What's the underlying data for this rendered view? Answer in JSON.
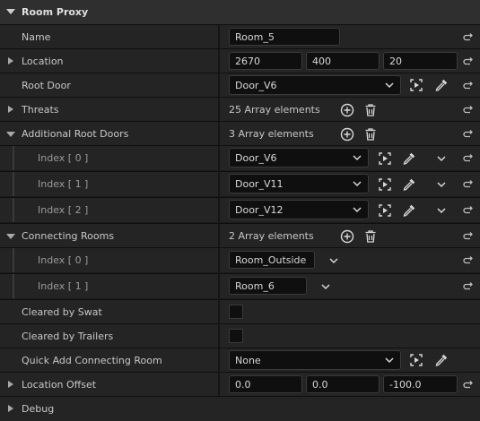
{
  "section": {
    "title": "Room Proxy"
  },
  "rows": {
    "name": {
      "label": "Name",
      "value": "Room_5"
    },
    "location": {
      "label": "Location",
      "x": "2670",
      "y": "400",
      "z": "20"
    },
    "root_door": {
      "label": "Root Door",
      "value": "Door_V6"
    },
    "threats": {
      "label": "Threats",
      "count": "25 Array elements"
    },
    "additional_root_doors": {
      "label": "Additional Root Doors",
      "count": "3 Array elements",
      "items": [
        {
          "label": "Index [ 0 ]",
          "value": "Door_V6"
        },
        {
          "label": "Index [ 1 ]",
          "value": "Door_V11"
        },
        {
          "label": "Index [ 2 ]",
          "value": "Door_V12"
        }
      ]
    },
    "connecting_rooms": {
      "label": "Connecting Rooms",
      "count": "2 Array elements",
      "items": [
        {
          "label": "Index [ 0 ]",
          "value": "Room_Outside"
        },
        {
          "label": "Index [ 1 ]",
          "value": "Room_6"
        }
      ]
    },
    "cleared_by_swat": {
      "label": "Cleared by Swat",
      "checked": false
    },
    "cleared_by_trailers": {
      "label": "Cleared by Trailers",
      "checked": false
    },
    "quick_add": {
      "label": "Quick Add Connecting Room",
      "value": "None"
    },
    "location_offset": {
      "label": "Location Offset",
      "x": "0.0",
      "y": "0.0",
      "z": "-100.0"
    },
    "debug": {
      "label": "Debug"
    }
  },
  "icons": {
    "reset": "reset-to-default-icon",
    "add": "add-element-icon",
    "delete": "delete-all-icon",
    "browse": "browse-asset-icon",
    "picker": "eyedropper-icon",
    "expand": "chevron-down-icon"
  }
}
